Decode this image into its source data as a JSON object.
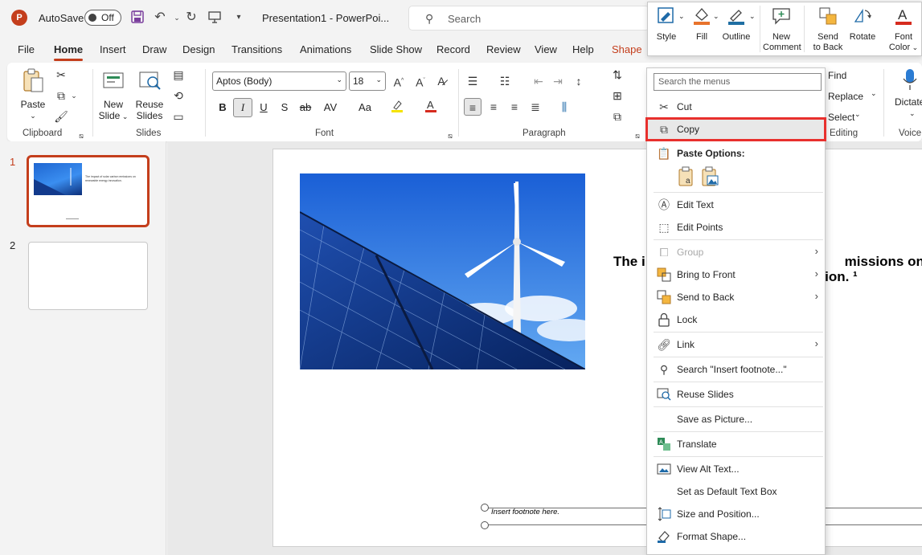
{
  "titlebar": {
    "autosave_label": "AutoSave",
    "autosave_state": "Off",
    "doc_title": "Presentation1  -  PowerPoi...",
    "search_placeholder": "Search"
  },
  "tabs": [
    "File",
    "Home",
    "Insert",
    "Draw",
    "Design",
    "Transitions",
    "Animations",
    "Slide Show",
    "Record",
    "Review",
    "View",
    "Help",
    "Shape"
  ],
  "active_tab": "Home",
  "ribbon": {
    "clipboard": {
      "paste": "Paste",
      "group": "Clipboard"
    },
    "slides": {
      "new_slide_1": "New",
      "new_slide_2": "Slide",
      "reuse_1": "Reuse",
      "reuse_2": "Slides",
      "group": "Slides"
    },
    "font": {
      "font_name": "Aptos (Body)",
      "font_size": "18",
      "group": "Font",
      "bold": "B",
      "italic": "I",
      "underline": "U",
      "shadow": "S",
      "strike": "ab",
      "spacing": "AV",
      "case": "Aa",
      "grow": "A",
      "shrink": "A"
    },
    "paragraph": {
      "group": "Paragraph"
    },
    "editing": {
      "find": "Find",
      "replace": "Replace",
      "select": "Select",
      "group": "Editing"
    },
    "voice": {
      "dictate": "Dictate",
      "group": "Voice"
    }
  },
  "slides_pane": {
    "items": [
      {
        "number": "1",
        "thumb_title": "The impact of solar carbon emissions on renewable energy innovation."
      },
      {
        "number": "2"
      }
    ]
  },
  "slide": {
    "heading_line1": "The i",
    "heading_line1_end": "missions on",
    "heading_line2_end": "ation. ¹",
    "footnote": "Insert footnote here."
  },
  "mini_toolbar": {
    "style": "Style",
    "fill": "Fill",
    "outline": "Outline",
    "new_comment_1": "New",
    "new_comment_2": "Comment",
    "send_back_1": "Send",
    "send_back_2": "to Back",
    "rotate": "Rotate",
    "font_color_1": "Font",
    "font_color_2": "Color",
    "colors": {
      "fill": "#e8732c",
      "outline": "#1f6fa3",
      "font_color": "#d62b1f"
    }
  },
  "context_menu": {
    "search_placeholder": "Search the menus",
    "items": {
      "cut": "Cut",
      "copy": "Copy",
      "paste_options": "Paste Options:",
      "edit_text": "Edit Text",
      "edit_points": "Edit Points",
      "group": "Group",
      "bring_front": "Bring to Front",
      "send_back": "Send to Back",
      "lock": "Lock",
      "link": "Link",
      "search": "Search \"Insert footnote...\"",
      "reuse_slides": "Reuse Slides",
      "save_picture": "Save as Picture...",
      "translate": "Translate",
      "alt_text": "View Alt Text...",
      "default_textbox": "Set as Default Text Box",
      "size_position": "Size and Position...",
      "format_shape": "Format Shape..."
    }
  },
  "accent_color": "#c43e1c",
  "highlight_border": "#e8302d"
}
